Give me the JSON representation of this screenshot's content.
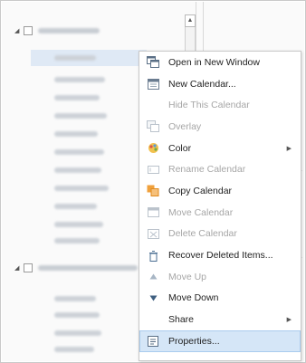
{
  "context_menu": {
    "items": [
      {
        "label": "Open in New Window",
        "icon": "open-window-icon",
        "enabled": true,
        "submenu": false
      },
      {
        "label": "New Calendar...",
        "icon": "new-calendar-icon",
        "enabled": true,
        "submenu": false
      },
      {
        "label": "Hide This Calendar",
        "icon": "",
        "enabled": false,
        "submenu": false
      },
      {
        "label": "Overlay",
        "icon": "overlay-icon",
        "enabled": false,
        "submenu": false
      },
      {
        "label": "Color",
        "icon": "color-palette-icon",
        "enabled": true,
        "submenu": true
      },
      {
        "label": "Rename Calendar",
        "icon": "rename-icon",
        "enabled": false,
        "submenu": false
      },
      {
        "label": "Copy Calendar",
        "icon": "copy-calendar-icon",
        "enabled": true,
        "submenu": false
      },
      {
        "label": "Move Calendar",
        "icon": "move-calendar-icon",
        "enabled": false,
        "submenu": false
      },
      {
        "label": "Delete Calendar",
        "icon": "delete-calendar-icon",
        "enabled": false,
        "submenu": false
      },
      {
        "label": "Recover Deleted Items...",
        "icon": "recover-icon",
        "enabled": true,
        "submenu": false
      },
      {
        "label": "Move Up",
        "icon": "move-up-icon",
        "enabled": false,
        "submenu": false
      },
      {
        "label": "Move Down",
        "icon": "move-down-icon",
        "enabled": true,
        "submenu": false
      },
      {
        "label": "Share",
        "icon": "",
        "enabled": true,
        "submenu": true
      },
      {
        "label": "Properties...",
        "icon": "properties-icon",
        "enabled": true,
        "submenu": false,
        "highlighted": true
      }
    ]
  },
  "scrollbar": {
    "up_glyph": "▲"
  },
  "submenu_glyph": "▶",
  "expander_glyph": "◢"
}
